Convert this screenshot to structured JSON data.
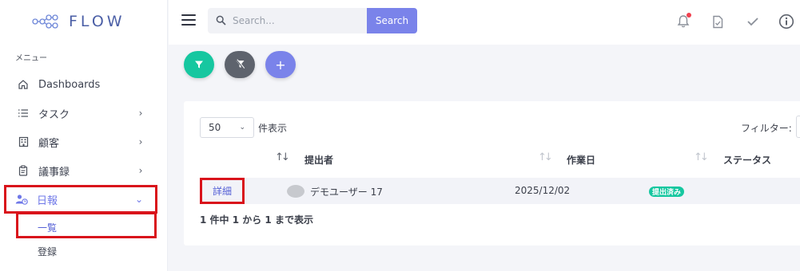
{
  "app": {
    "logo_text": "FLOW"
  },
  "sidebar": {
    "menu_caption": "メニュー",
    "items": [
      {
        "label": "Dashboards",
        "icon": "home-icon"
      },
      {
        "label": "タスク",
        "icon": "list-icon"
      },
      {
        "label": "顧客",
        "icon": "building-icon"
      },
      {
        "label": "議事録",
        "icon": "clipboard-icon"
      },
      {
        "label": "日報",
        "icon": "user-clock-icon"
      }
    ],
    "subitems": [
      {
        "label": "一覧"
      },
      {
        "label": "登録"
      }
    ]
  },
  "header": {
    "search_placeholder": "Search...",
    "search_button": "Search"
  },
  "table": {
    "length_value": "50",
    "length_suffix": "件表示",
    "filter_label": "フィルター:",
    "columns": [
      "提出者",
      "作業日",
      "ステータス"
    ],
    "rows": [
      {
        "action": "詳細",
        "submitter": "デモユーザー 17",
        "date": "2025/12/02",
        "status": "提出済み"
      }
    ],
    "info": "1 件中 1 から 1 まで表示"
  },
  "colors": {
    "accent": "#7a83ea",
    "success": "#16c7a0",
    "highlight": "#d9131b"
  }
}
